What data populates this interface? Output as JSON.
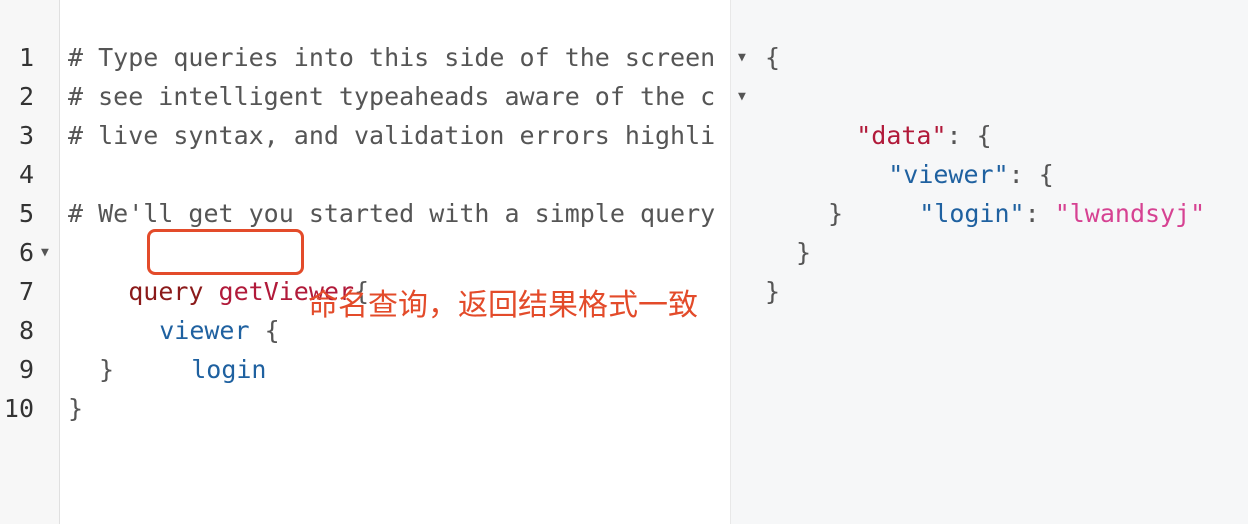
{
  "line_numbers": [
    "1",
    "2",
    "3",
    "4",
    "5",
    "6",
    "7",
    "8",
    "9",
    "10"
  ],
  "query": {
    "comment1": "# Type queries into this side of the screen",
    "comment2": "# see intelligent typeaheads aware of the c",
    "comment3": "# live syntax, and validation errors highli",
    "comment5": "# We'll get you started with a simple query",
    "keyword": "query",
    "name": "getViewer",
    "brace_open": "{",
    "field_viewer": "viewer",
    "field_login": "login",
    "brace_close": "}"
  },
  "result": {
    "open": "{",
    "data_key": "\"data\"",
    "viewer_key": "\"viewer\"",
    "login_key": "\"login\"",
    "login_value": "\"lwandsyj\"",
    "colon_brace": ": {",
    "colon": ": ",
    "close": "}"
  },
  "annotation": {
    "text": "命名查询，返回结果格式一致",
    "color": "#e34b2a"
  }
}
